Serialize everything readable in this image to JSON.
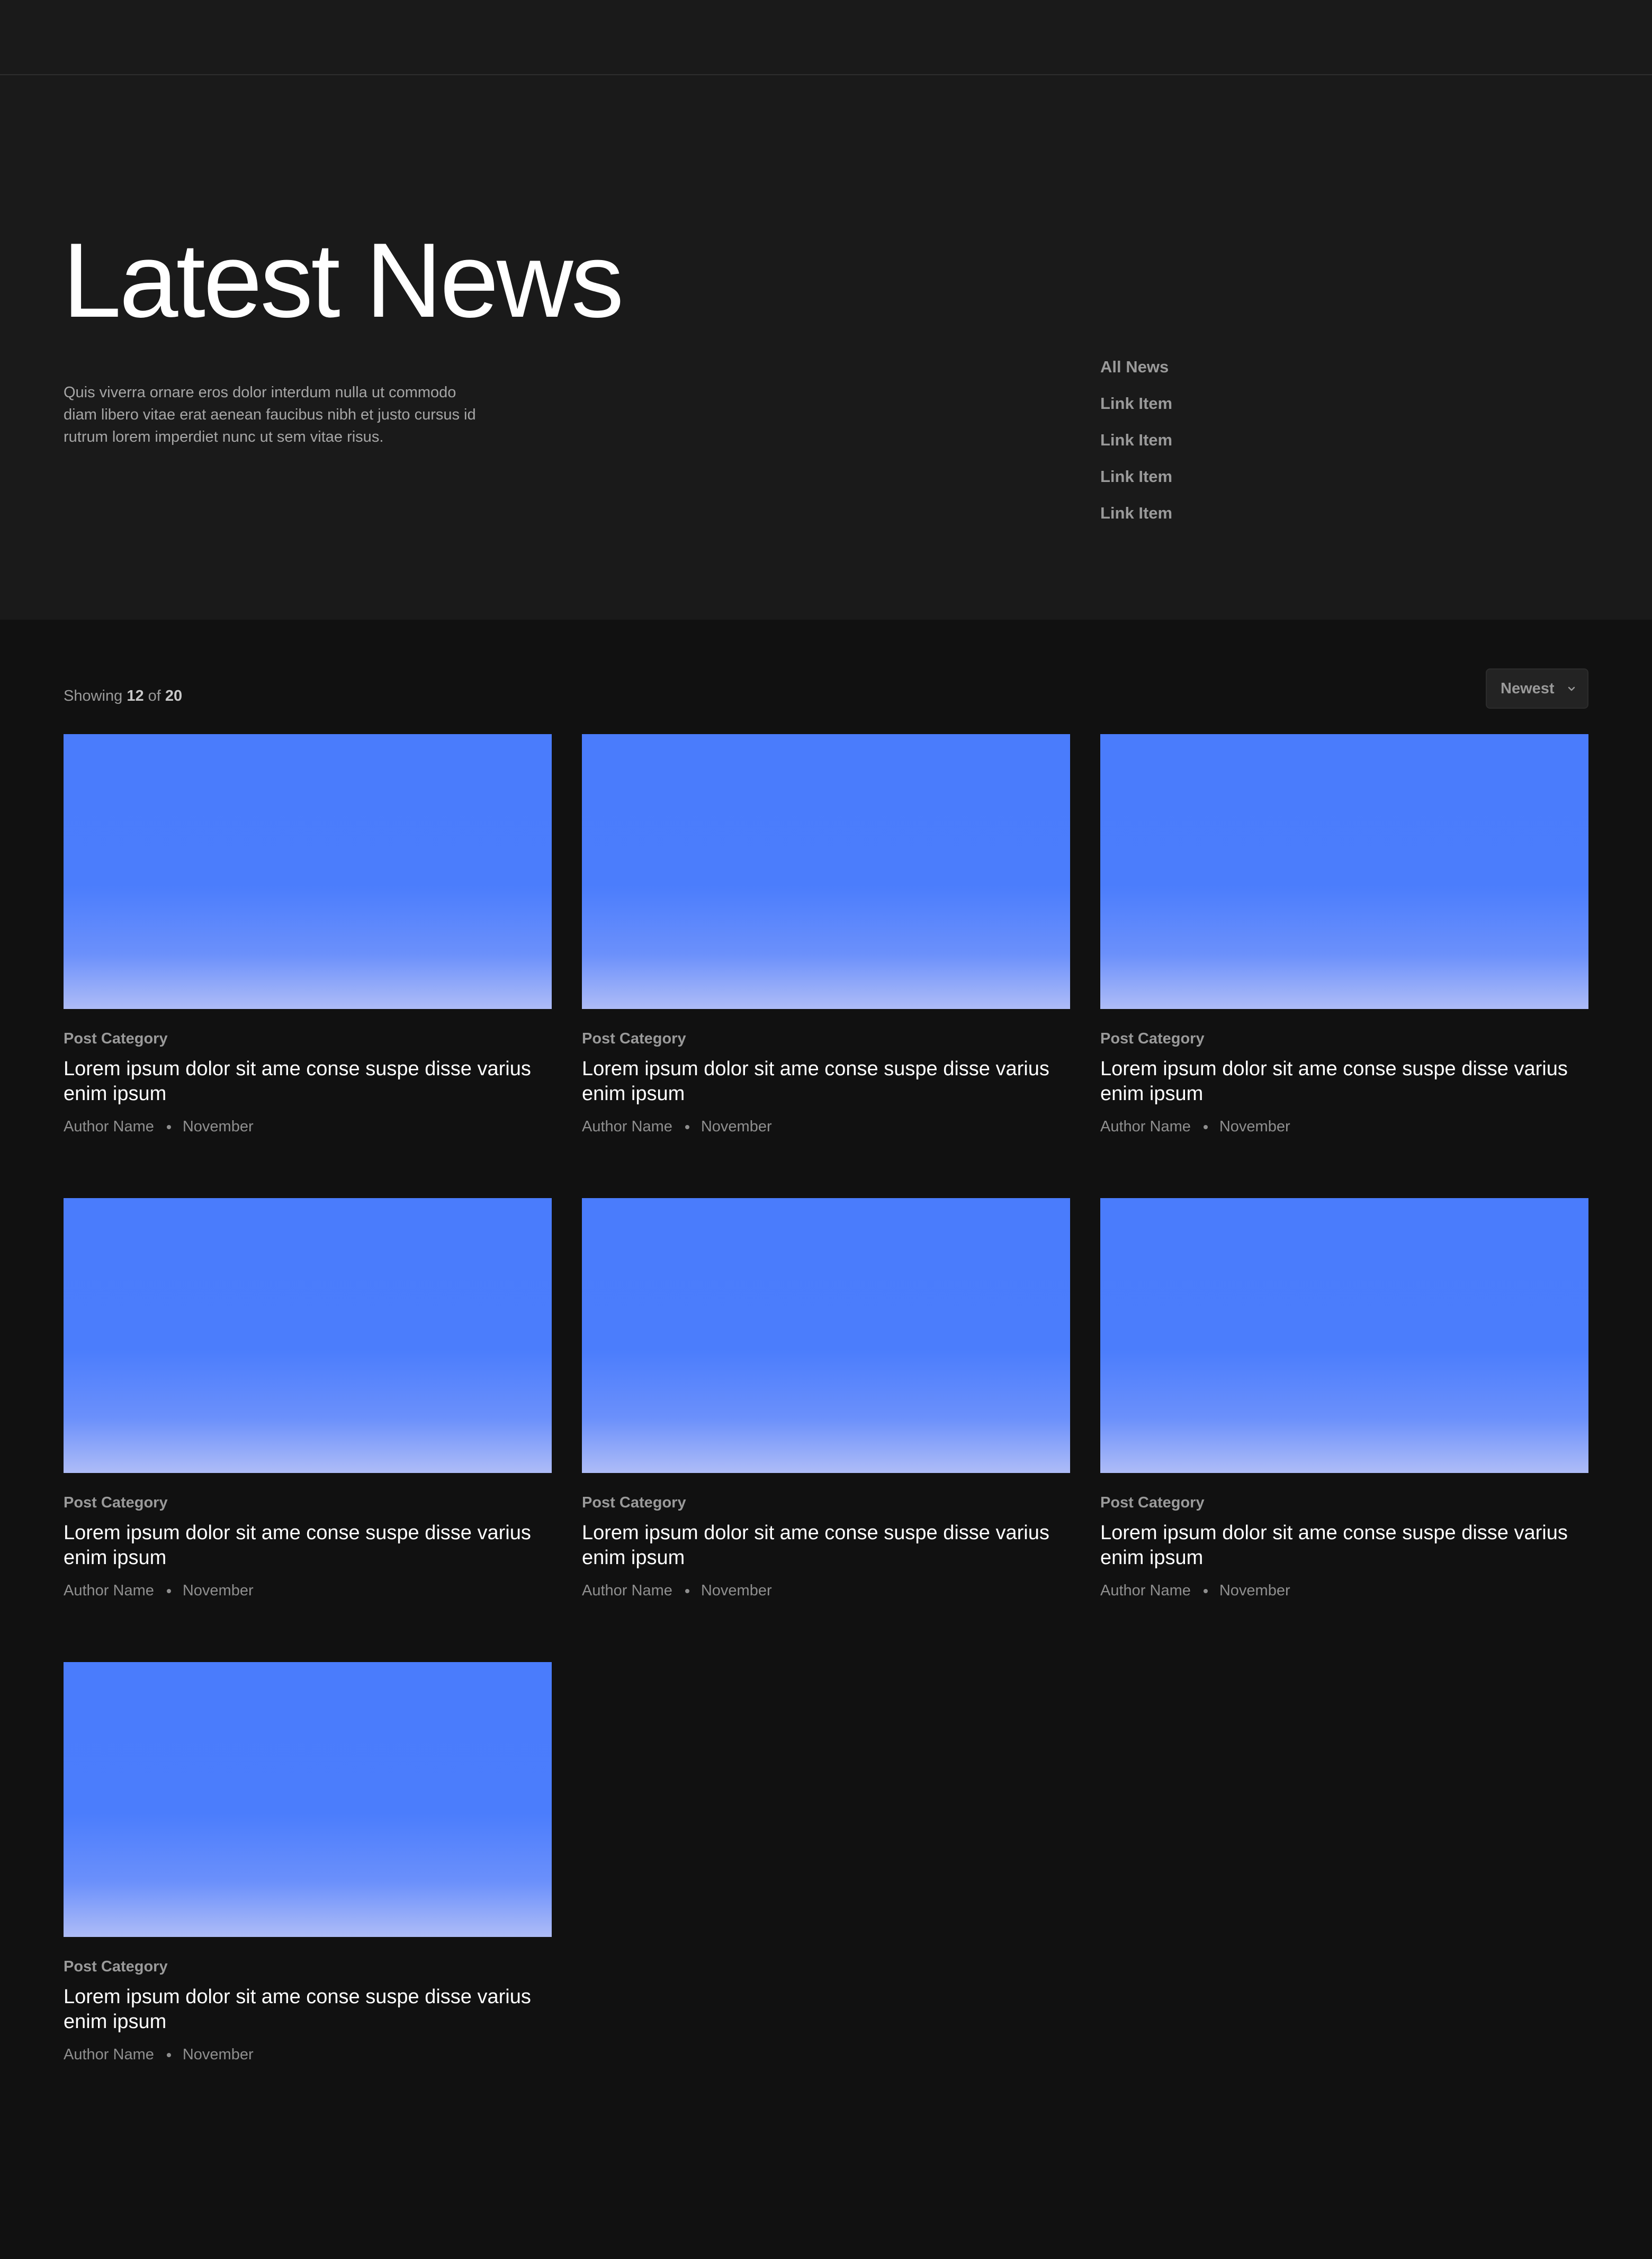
{
  "hero": {
    "title": "Latest News",
    "description": "Quis viverra ornare eros dolor interdum nulla ut commodo diam libero vitae erat aenean faucibus nibh et justo cursus id rutrum lorem imperdiet nunc ut sem vitae risus.",
    "nav": [
      {
        "label": "All News"
      },
      {
        "label": "Link Item"
      },
      {
        "label": "Link Item"
      },
      {
        "label": "Link Item"
      },
      {
        "label": "Link Item"
      }
    ]
  },
  "listing": {
    "showing_prefix": "Showing",
    "showing_count": "12",
    "showing_of": "of",
    "showing_total": "20",
    "sort_label": "Newest",
    "sort_icon": "chevron-down-icon"
  },
  "posts": [
    {
      "category": "Post Category",
      "title": "Lorem ipsum dolor sit ame conse suspe disse varius enim ipsum",
      "author": "Author Name",
      "date": "November"
    },
    {
      "category": "Post Category",
      "title": "Lorem ipsum dolor sit ame conse suspe disse varius enim ipsum",
      "author": "Author Name",
      "date": "November"
    },
    {
      "category": "Post Category",
      "title": "Lorem ipsum dolor sit ame conse suspe disse varius enim ipsum",
      "author": "Author Name",
      "date": "November"
    },
    {
      "category": "Post Category",
      "title": "Lorem ipsum dolor sit ame conse suspe disse varius enim ipsum",
      "author": "Author Name",
      "date": "November"
    },
    {
      "category": "Post Category",
      "title": "Lorem ipsum dolor sit ame conse suspe disse varius enim ipsum",
      "author": "Author Name",
      "date": "November"
    },
    {
      "category": "Post Category",
      "title": "Lorem ipsum dolor sit ame conse suspe disse varius enim ipsum",
      "author": "Author Name",
      "date": "November"
    },
    {
      "category": "Post Category",
      "title": "Lorem ipsum dolor sit ame conse suspe disse varius enim ipsum",
      "author": "Author Name",
      "date": "November"
    }
  ],
  "colors": {
    "page_background": "#111111",
    "hero_background": "#1a1a1a",
    "image_top": "#4a7cfc",
    "image_bottom": "#aebcf7"
  }
}
